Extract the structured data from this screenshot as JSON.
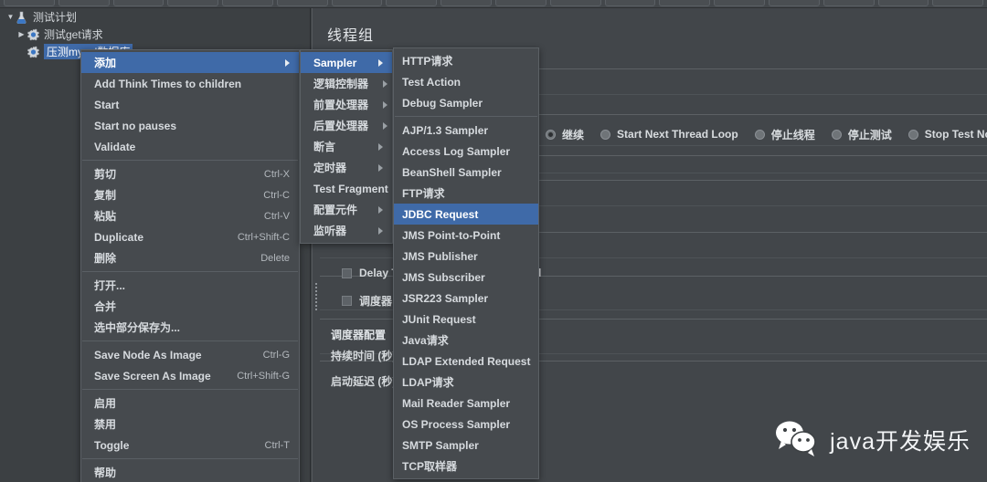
{
  "app": {
    "theme_bg": "#3c4043",
    "accent": "#3f6aa8",
    "panel_bg": "#42464a",
    "menu_bg": "#464a4e"
  },
  "toolbar": {
    "button_count": 18
  },
  "tree": {
    "items": [
      {
        "label": "测试计划",
        "icon": "test-plan-icon",
        "twisty": "▼",
        "depth": 0,
        "selected": false
      },
      {
        "label": "测试get请求",
        "icon": "gear-icon",
        "twisty": "▶",
        "depth": 1,
        "selected": false
      },
      {
        "label": "压测mysql数据库",
        "icon": "gear-icon",
        "twisty": "",
        "depth": 1,
        "selected": true
      }
    ]
  },
  "editor": {
    "title": "线程组",
    "action_after_error_options": [
      {
        "label": "继续",
        "selected": true
      },
      {
        "label": "Start Next Thread Loop",
        "selected": false
      },
      {
        "label": "停止线程",
        "selected": false
      },
      {
        "label": "停止测试",
        "selected": false
      },
      {
        "label": "Stop Test Now",
        "selected": false
      }
    ],
    "delay_checkbox_label": "Delay Thread creation until needed",
    "scheduler_checkbox_label": "调度器",
    "scheduler_section_label": "调度器配置",
    "duration_label": "持续时间 (秒)",
    "startup_delay_label": "启动延迟 (秒)"
  },
  "context_menu": {
    "items": [
      {
        "label": "添加",
        "accel": "",
        "submenu": true,
        "selected": true
      },
      {
        "label": "Add Think Times to children",
        "accel": "",
        "submenu": false,
        "selected": false
      },
      {
        "label": "Start",
        "accel": "",
        "submenu": false,
        "selected": false
      },
      {
        "label": "Start no pauses",
        "accel": "",
        "submenu": false,
        "selected": false
      },
      {
        "label": "Validate",
        "accel": "",
        "submenu": false,
        "selected": false
      },
      {
        "separator": true
      },
      {
        "label": "剪切",
        "accel": "Ctrl-X",
        "submenu": false,
        "selected": false
      },
      {
        "label": "复制",
        "accel": "Ctrl-C",
        "submenu": false,
        "selected": false
      },
      {
        "label": "粘贴",
        "accel": "Ctrl-V",
        "submenu": false,
        "selected": false
      },
      {
        "label": "Duplicate",
        "accel": "Ctrl+Shift-C",
        "submenu": false,
        "selected": false
      },
      {
        "label": "删除",
        "accel": "Delete",
        "submenu": false,
        "selected": false
      },
      {
        "separator": true
      },
      {
        "label": "打开...",
        "accel": "",
        "submenu": false,
        "selected": false
      },
      {
        "label": "合并",
        "accel": "",
        "submenu": false,
        "selected": false
      },
      {
        "label": "选中部分保存为...",
        "accel": "",
        "submenu": false,
        "selected": false
      },
      {
        "separator": true
      },
      {
        "label": "Save Node As Image",
        "accel": "Ctrl-G",
        "submenu": false,
        "selected": false
      },
      {
        "label": "Save Screen As Image",
        "accel": "Ctrl+Shift-G",
        "submenu": false,
        "selected": false
      },
      {
        "separator": true
      },
      {
        "label": "启用",
        "accel": "",
        "submenu": false,
        "selected": false
      },
      {
        "label": "禁用",
        "accel": "",
        "submenu": false,
        "selected": false
      },
      {
        "label": "Toggle",
        "accel": "Ctrl-T",
        "submenu": false,
        "selected": false
      },
      {
        "separator": true
      },
      {
        "label": "帮助",
        "accel": "",
        "submenu": false,
        "selected": false
      }
    ]
  },
  "add_submenu": {
    "items": [
      {
        "label": "Sampler",
        "submenu": true,
        "selected": true
      },
      {
        "label": "逻辑控制器",
        "submenu": true,
        "selected": false
      },
      {
        "label": "前置处理器",
        "submenu": true,
        "selected": false
      },
      {
        "label": "后置处理器",
        "submenu": true,
        "selected": false
      },
      {
        "label": "断言",
        "submenu": true,
        "selected": false
      },
      {
        "label": "定时器",
        "submenu": true,
        "selected": false
      },
      {
        "label": "Test Fragment",
        "submenu": true,
        "selected": false
      },
      {
        "label": "配置元件",
        "submenu": true,
        "selected": false
      },
      {
        "label": "监听器",
        "submenu": true,
        "selected": false
      }
    ]
  },
  "sampler_submenu": {
    "items": [
      {
        "label": "HTTP请求",
        "selected": false
      },
      {
        "label": "Test Action",
        "selected": false
      },
      {
        "label": "Debug Sampler",
        "selected": false
      },
      {
        "separator": true
      },
      {
        "label": "AJP/1.3 Sampler",
        "selected": false
      },
      {
        "label": "Access Log Sampler",
        "selected": false
      },
      {
        "label": "BeanShell Sampler",
        "selected": false
      },
      {
        "label": "FTP请求",
        "selected": false
      },
      {
        "label": "JDBC Request",
        "selected": true
      },
      {
        "label": "JMS Point-to-Point",
        "selected": false
      },
      {
        "label": "JMS Publisher",
        "selected": false
      },
      {
        "label": "JMS Subscriber",
        "selected": false
      },
      {
        "label": "JSR223 Sampler",
        "selected": false
      },
      {
        "label": "JUnit Request",
        "selected": false
      },
      {
        "label": "Java请求",
        "selected": false
      },
      {
        "label": "LDAP Extended Request",
        "selected": false
      },
      {
        "label": "LDAP请求",
        "selected": false
      },
      {
        "label": "Mail Reader Sampler",
        "selected": false
      },
      {
        "label": "OS Process Sampler",
        "selected": false
      },
      {
        "label": "SMTP Sampler",
        "selected": false
      },
      {
        "label": "TCP取样器",
        "selected": false
      }
    ]
  },
  "watermark": {
    "text": "java开发娱乐",
    "icon": "wechat-icon"
  }
}
